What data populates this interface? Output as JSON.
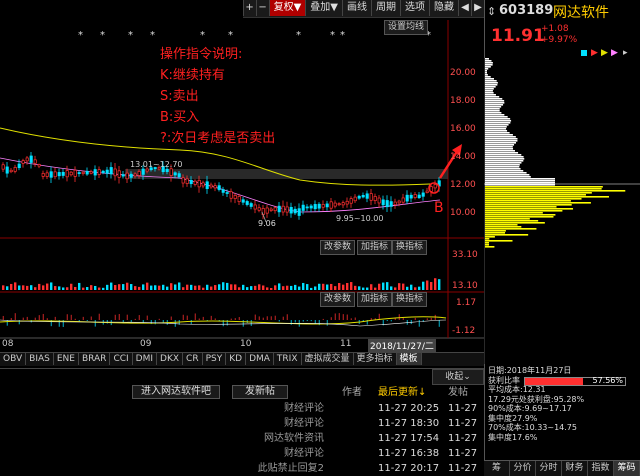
{
  "toolbar": {
    "items": [
      "+",
      "−",
      "复权▼",
      "叠加▼",
      "画线",
      "周期",
      "选项",
      "隐藏",
      "◀",
      "▶"
    ]
  },
  "chart": {
    "settings_button": "设置均线",
    "star_marks": [
      "*",
      "*",
      "*",
      "*",
      "*",
      "*",
      "*",
      "*",
      "*",
      "*"
    ],
    "y_ticks": [
      "20.00",
      "18.00",
      "16.00",
      "14.00",
      "12.00",
      "10.00"
    ],
    "annotations": {
      "title": "操作指令说明:",
      "k": "K:继续持有",
      "s": "S:卖出",
      "b": "B:买入",
      "q": "?:次日考虑是否卖出"
    },
    "range_label": "13.01~12.70",
    "low_label": "9.95~10.00",
    "low_point": "9.06",
    "signal_b": "B",
    "date_cursor": "2018/11/27/二",
    "x_labels": [
      "08",
      "09",
      "10",
      "11"
    ],
    "sub_buttons": {
      "params": "改参数",
      "add": "加指标",
      "swap": "换指标"
    },
    "vol_ticks": [
      "33.10",
      "13.10"
    ],
    "macd_ticks": [
      "1.17",
      "-1.12"
    ]
  },
  "indicator_tabs": [
    "OBV",
    "BIAS",
    "ENE",
    "BRAR",
    "CCI",
    "DMI",
    "DKX",
    "CR",
    "PSY",
    "KD",
    "DMA",
    "TRIX",
    "虚拟成交量",
    "更多指标",
    "模板"
  ],
  "stock": {
    "code": "603189",
    "name": "网达软件",
    "price": "11.91",
    "change": "+1.08",
    "pct": "+9.97%"
  },
  "colors": {
    "up": "#ff3030",
    "down": "#00e0ff",
    "ma": "#e0e000",
    "accent": "#b00000",
    "annot": "#ff2020",
    "volume_profile": "#ffff00"
  },
  "forum": {
    "collapse": "收起",
    "btn_enter": "进入网达软件吧",
    "btn_post": "发新帖",
    "headers": {
      "author": "作者",
      "latest": "最后更新↓",
      "post": "发帖"
    },
    "rows": [
      {
        "author": "财经评论",
        "updated": "11-27 20:25",
        "posted": "11-27"
      },
      {
        "author": "财经评论",
        "updated": "11-27 18:30",
        "posted": "11-27"
      },
      {
        "author": "网达软件资讯",
        "updated": "11-27 17:54",
        "posted": "11-27"
      },
      {
        "author": "财经评论",
        "updated": "11-27 16:38",
        "posted": "11-27"
      },
      {
        "author": "此贴禁止回复2",
        "updated": "11-27 20:17",
        "posted": "11-27"
      }
    ]
  },
  "info": {
    "date": "日期:2018年11月27日",
    "profit_ratio_label": "获利比率",
    "profit_ratio_value": "57.56%",
    "avg_cost": "平均成本:12.31",
    "profit_ratio_line": "17.29元处获利盘:95.28%",
    "cost90": "90%成本:9.69~17.17",
    "conc90": "集中度27.9%",
    "cost70": "70%成本:10.33~14.75",
    "conc70": "集中度17.6%"
  },
  "bottom_tabs": [
    "筹",
    "分价",
    "分时",
    "财务",
    "指数",
    "筹码"
  ]
}
